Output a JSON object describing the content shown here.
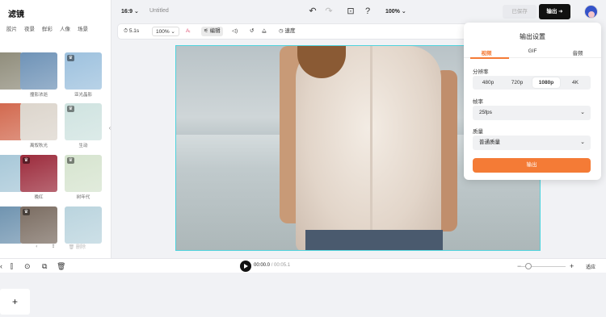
{
  "left_panel": {
    "title": "滤镜",
    "tabs": [
      "胶片",
      "夜景",
      "鲜彩",
      "人像",
      "场景"
    ],
    "thumbs": [
      {
        "label": "",
        "bg": "#8d8a78",
        "crown": false
      },
      {
        "label": "撞影浓逝",
        "bg": "#6f93b7",
        "crown": false
      },
      {
        "label": "亚光晶影",
        "bg": "#9dc1de",
        "crown": true
      },
      {
        "label": "",
        "bg": "#d1654a",
        "crown": false
      },
      {
        "label": "离叙秋光",
        "bg": "#dcd5cc",
        "crown": false
      },
      {
        "label": "生动",
        "bg": "#cfe3e0",
        "crown": true
      },
      {
        "label": "",
        "bg": "#a5c6d7",
        "crown": false
      },
      {
        "label": "晚红",
        "bg": "#9c2b3c",
        "crown": true
      },
      {
        "label": "树年代",
        "bg": "#d6e4cf",
        "crown": true
      },
      {
        "label": "",
        "bg": "#6c91ae",
        "crown": false
      },
      {
        "label": "",
        "bg": "#7b6d62",
        "crown": true
      },
      {
        "label": "",
        "bg": "#bad4de",
        "crown": false
      }
    ],
    "tools": {
      "delete_label": "删除"
    }
  },
  "topbar": {
    "ratio": "16:9",
    "doc_title": "Untitled",
    "zoom": "100%",
    "saved_label": "已保存",
    "export_label": "输出"
  },
  "edit_toolbar": {
    "duration": "5.1s",
    "scale": "100%",
    "edit_label": "编辑",
    "speed_label": "速度"
  },
  "timeline": {
    "current": "00:00.0",
    "total": "00:05.1",
    "fit_label": "适应"
  },
  "export_popup": {
    "title": "输出设置",
    "tabs": [
      "视频",
      "GIF",
      "音频"
    ],
    "resolution_label": "分辨率",
    "resolutions": [
      "480p",
      "720p",
      "1080p",
      "4K"
    ],
    "selected_resolution": "1080p",
    "framerate_label": "帧率",
    "framerate_value": "25fps",
    "quality_label": "质量",
    "quality_value": "普通质量",
    "export_label": "输出"
  },
  "colors": {
    "accent": "#f47b36",
    "canvas_border": "#4fd3dd"
  }
}
